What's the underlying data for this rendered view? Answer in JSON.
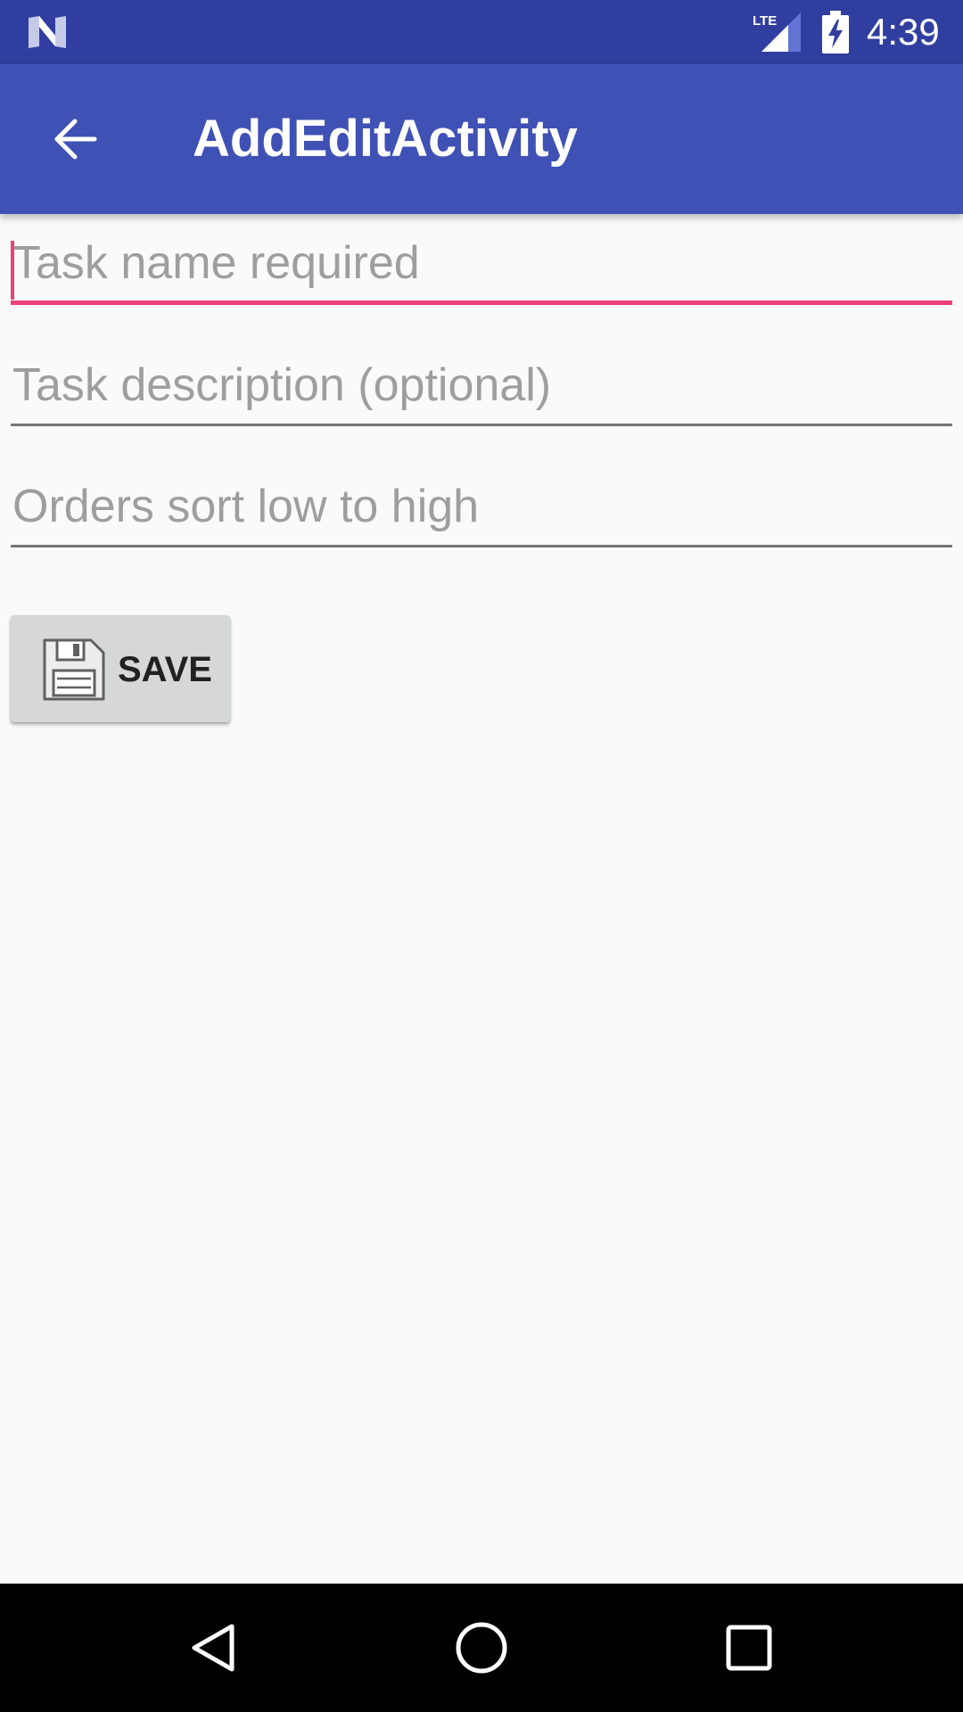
{
  "status_bar": {
    "time": "4:39",
    "network": "LTE",
    "icons": [
      "n-logo-icon",
      "lte-signal-icon",
      "battery-charging-icon"
    ]
  },
  "app_bar": {
    "title": "AddEditActivity",
    "back_icon": "arrow-back-icon",
    "color": "#3f51b5",
    "status_color": "#303f9f"
  },
  "form": {
    "task_name": {
      "value": "",
      "placeholder": "Task name required",
      "focused": true
    },
    "task_description": {
      "value": "",
      "placeholder": "Task description (optional)"
    },
    "sort_order": {
      "value": "",
      "placeholder": "Orders sort low to high"
    },
    "accent_color": "#ec407a"
  },
  "save_button": {
    "label": "SAVE",
    "icon": "floppy-disk-icon"
  },
  "nav_bar": {
    "icons": [
      "back-triangle-icon",
      "home-circle-icon",
      "recents-square-icon"
    ]
  }
}
